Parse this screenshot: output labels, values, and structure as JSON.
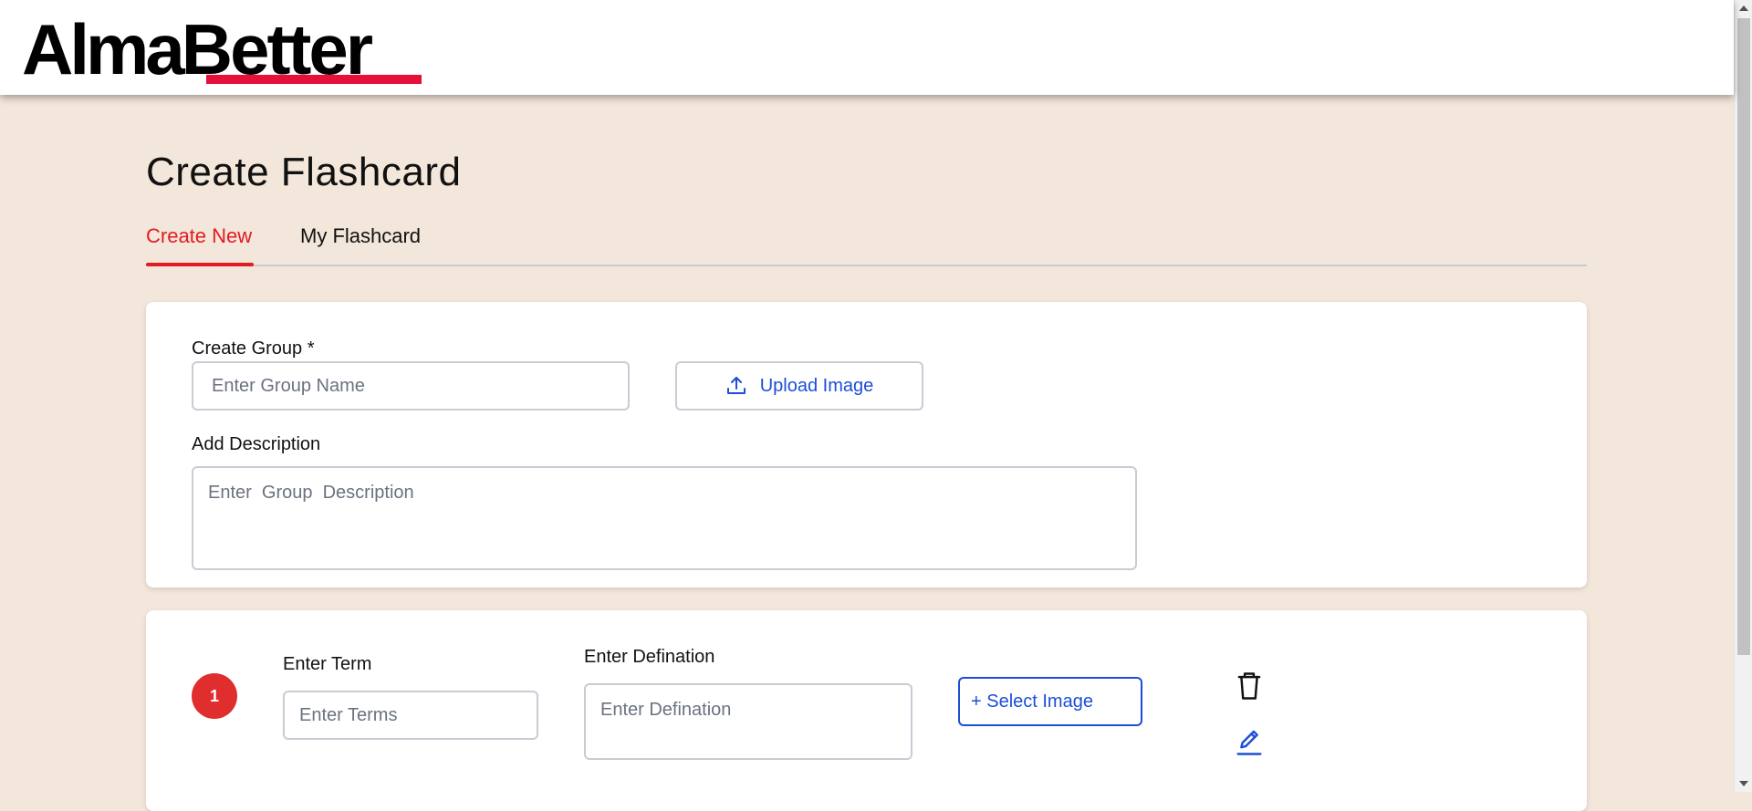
{
  "header": {
    "logo_part1": "Alma",
    "logo_part2": "Better",
    "brand_color": "#e6103b"
  },
  "page": {
    "title": "Create Flashcard"
  },
  "tabs": [
    {
      "label": "Create New",
      "active": true
    },
    {
      "label": "My Flashcard",
      "active": false
    }
  ],
  "group_form": {
    "group_label": "Create Group *",
    "group_placeholder": "Enter Group Name",
    "upload_label": "Upload Image",
    "upload_icon": "upload-icon",
    "description_label": "Add Description",
    "description_placeholder": "Enter  Group  Description"
  },
  "term_card": {
    "number": "1",
    "term_label": "Enter Term",
    "term_placeholder": "Enter Terms",
    "definition_label": "Enter Defination",
    "definition_placeholder": "Enter Defination",
    "select_image_label": "+ Select Image",
    "delete_icon": "trash-icon",
    "edit_icon": "pencil-icon"
  },
  "colors": {
    "accent": "#e31b23",
    "link": "#1d4ed8",
    "background": "#f3e6da",
    "badge": "#e02d2d"
  }
}
